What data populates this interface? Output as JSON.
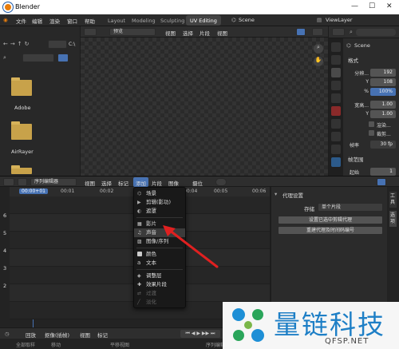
{
  "app": {
    "title": "Blender"
  },
  "window_controls": [
    "—",
    "☐",
    "✕"
  ],
  "menubar": {
    "items": [
      "文件",
      "编辑",
      "渲染",
      "窗口",
      "帮助"
    ],
    "workspaces": [
      "Layout",
      "Modeling",
      "Sculpting",
      "UV Editing"
    ],
    "scene": "Scene",
    "view_layer": "ViewLayer"
  },
  "file_browser": {
    "menus": [
      "视图",
      "选择"
    ],
    "path": "C:\\",
    "folders": [
      "Adobe",
      "AirRayer"
    ]
  },
  "viewport": {
    "preview_label": "预览",
    "menus": [
      "视图",
      "选择",
      "片段",
      "视图"
    ]
  },
  "properties": {
    "scene": "Scene",
    "section_format": "格式",
    "rows": [
      {
        "label": "分辨...",
        "value": "192"
      },
      {
        "label": "Y",
        "value": "108"
      },
      {
        "label": "%",
        "value": "100%"
      },
      {
        "label": "宽高...",
        "value": "1.00"
      },
      {
        "label": "Y",
        "value": "1.00"
      }
    ],
    "checks": [
      "渲染...",
      "裁剪..."
    ],
    "fps_label": "帧率",
    "fps": "30 fp",
    "section_range": "帧范围",
    "start_label": "起始",
    "start": "1"
  },
  "sequencer": {
    "editor_name": "序列编辑器",
    "menus": [
      "视图",
      "选择",
      "标记",
      "添加",
      "片段",
      "图像"
    ],
    "overlay": "摄位",
    "timecodes": [
      "00:00+01",
      "00:01",
      "00:02",
      "00:03",
      "00:04",
      "00:05",
      "00:06"
    ],
    "channels": [
      "6",
      "5",
      "4",
      "3",
      "2"
    ]
  },
  "add_menu": {
    "items": [
      "场景",
      "剪辑(影功)",
      "遮罩",
      "影片",
      "声音",
      "图像/序列",
      "颜色",
      "文本",
      "调整层",
      "效果片段",
      "过渡",
      "淡化"
    ]
  },
  "proxy_panel": {
    "title": "代理设置",
    "storage_label": "存储",
    "storage_value": "单个片段",
    "set_button": "设置已选中剪辑代理",
    "rebuild_button": "重建代理及时间码编号",
    "tabs": [
      "工具",
      "选项"
    ]
  },
  "footer": {
    "menus": [
      "回放",
      "抠像(插帧)",
      "视图",
      "标记"
    ],
    "mode": "序列编辑"
  },
  "status": {
    "items": [
      "全部取样",
      "移动",
      "平移视图"
    ]
  },
  "watermark": {
    "brand": "量链科技",
    "url": "QFSP.NET"
  },
  "colors": {
    "accent": "#4772b3",
    "arrow": "#e02020",
    "folder": "#c8a24a"
  }
}
